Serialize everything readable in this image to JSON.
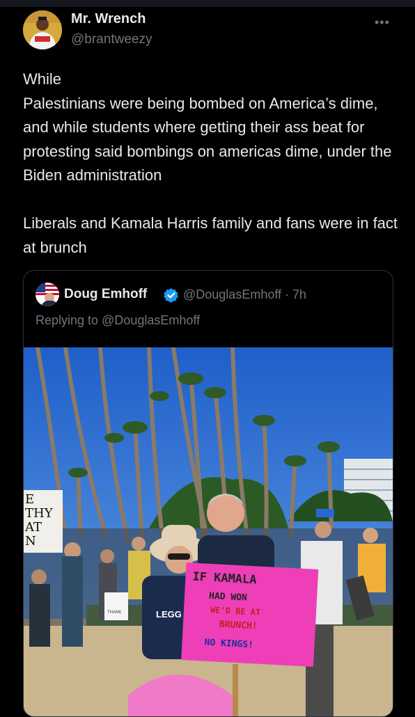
{
  "tweet": {
    "display_name": "Mr. Wrench",
    "handle": "@brantweezy",
    "more_icon": "more-dots-icon",
    "text": "While\nPalestinians were being bombed on America’s dime, and while students where getting their ass beat for protesting said bombings on americas dime, under the Biden administration\n\nLiberals and Kamala Harris family and fans were in fact at brunch"
  },
  "quote": {
    "display_name": "Doug Emhoff",
    "verified_icon": "verified-badge-icon",
    "handle_time": "@DouglasEmhoff · 7h",
    "replying": "Replying to @DouglasEmhoff",
    "photo": {
      "sign_line1": "IF  KAMALA",
      "sign_line2": "HAD WON",
      "sign_line3": "WE'D BE AT",
      "sign_line4": "BRUNCH!",
      "sign_line5": "NO KINGS!",
      "left_sign_line1": "E",
      "left_sign_line2": "THY",
      "left_sign_line3": "AT",
      "left_sign_line4": "N",
      "shirt_text": "LEGG",
      "small_sign": "THANK"
    }
  },
  "colors": {
    "background": "#000000",
    "text": "#e7e9ea",
    "muted": "#71767b",
    "border": "#2f3336",
    "verified": "#1d9bf0",
    "sign_pink": "#ee3fb8"
  }
}
